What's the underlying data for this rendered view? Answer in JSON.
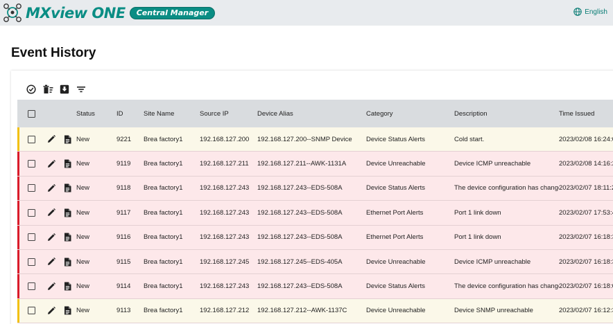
{
  "header": {
    "brand_name": "MXview ONE",
    "brand_badge": "Central Manager",
    "language": "English",
    "icons": {
      "logo": "moxa-logo-icon",
      "language": "globe-icon"
    },
    "colors": {
      "brand": "#0a8d84",
      "header_bg": "#e8ebee"
    }
  },
  "page": {
    "title": "Event History"
  },
  "toolbar": {
    "icons": [
      "acknowledge-icon",
      "delete-list-icon",
      "export-icon",
      "filter-icon"
    ]
  },
  "table": {
    "columns": {
      "status": "Status",
      "id": "ID",
      "site": "Site Name",
      "ip": "Source IP",
      "alias": "Device Alias",
      "category": "Category",
      "description": "Description",
      "time": "Time Issued"
    },
    "severity_colors": {
      "warning": "#f2c00f",
      "critical": "#d91b2a"
    },
    "rows": [
      {
        "severity": "warning",
        "status": "New",
        "id": "9221",
        "site": "Brea factory1",
        "ip": "192.168.127.200",
        "alias": "192.168.127.200--SNMP Device",
        "category": "Device Status Alerts",
        "description": "Cold start.",
        "time": "2023/02/08 16:24:0"
      },
      {
        "severity": "critical",
        "status": "New",
        "id": "9119",
        "site": "Brea factory1",
        "ip": "192.168.127.211",
        "alias": "192.168.127.211--AWK-1131A",
        "category": "Device Unreachable",
        "description": "Device ICMP unreachable",
        "time": "2023/02/08 14:16:2"
      },
      {
        "severity": "critical",
        "status": "New",
        "id": "9118",
        "site": "Brea factory1",
        "ip": "192.168.127.243",
        "alias": "192.168.127.243--EDS-508A",
        "category": "Device Status Alerts",
        "description": "The device configuration has changed.",
        "time": "2023/02/07 18:11:2"
      },
      {
        "severity": "critical",
        "status": "New",
        "id": "9117",
        "site": "Brea factory1",
        "ip": "192.168.127.243",
        "alias": "192.168.127.243--EDS-508A",
        "category": "Ethernet Port Alerts",
        "description": "Port 1 link down",
        "time": "2023/02/07 17:53:4"
      },
      {
        "severity": "critical",
        "status": "New",
        "id": "9116",
        "site": "Brea factory1",
        "ip": "192.168.127.243",
        "alias": "192.168.127.243--EDS-508A",
        "category": "Ethernet Port Alerts",
        "description": "Port 1 link down",
        "time": "2023/02/07 16:18:3"
      },
      {
        "severity": "critical",
        "status": "New",
        "id": "9115",
        "site": "Brea factory1",
        "ip": "192.168.127.245",
        "alias": "192.168.127.245--EDS-405A",
        "category": "Device Unreachable",
        "description": "Device ICMP unreachable",
        "time": "2023/02/07 16:18:3"
      },
      {
        "severity": "critical",
        "status": "New",
        "id": "9114",
        "site": "Brea factory1",
        "ip": "192.168.127.243",
        "alias": "192.168.127.243--EDS-508A",
        "category": "Device Status Alerts",
        "description": "The device configuration has changed.",
        "time": "2023/02/07 16:18:0"
      },
      {
        "severity": "warning",
        "status": "New",
        "id": "9113",
        "site": "Brea factory1",
        "ip": "192.168.127.212",
        "alias": "192.168.127.212--AWK-1137C",
        "category": "Device Unreachable",
        "description": "Device SNMP unreachable",
        "time": "2023/02/07 16:12:3"
      }
    ]
  }
}
